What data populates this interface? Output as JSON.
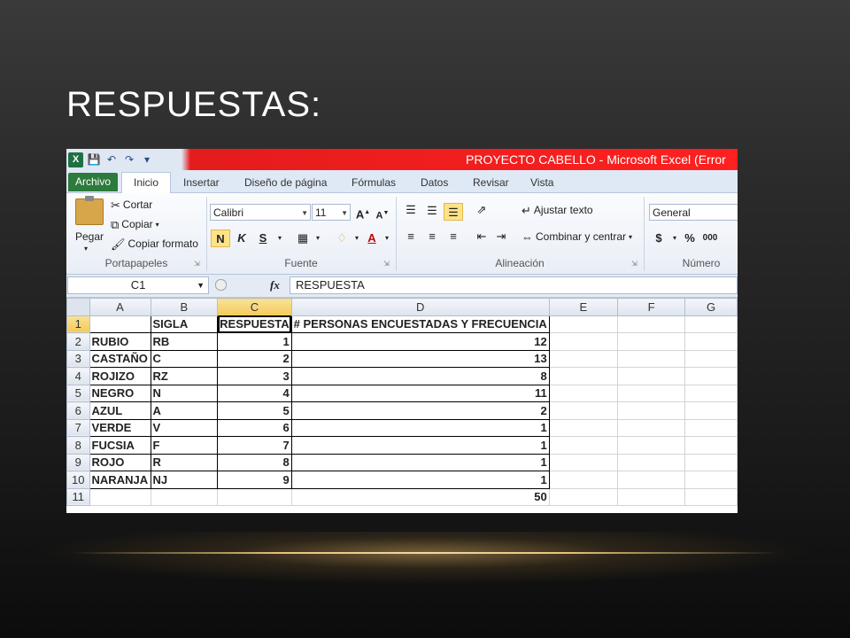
{
  "slide": {
    "title": "RESPUESTAS:"
  },
  "window": {
    "title": "PROYECTO CABELLO  -  Microsoft Excel (Error",
    "logo": "X",
    "qat_icons": [
      "save-icon",
      "undo-icon",
      "redo-icon",
      "customize-qat-icon"
    ]
  },
  "tabs": [
    "Archivo",
    "Inicio",
    "Insertar",
    "Diseño de página",
    "Fórmulas",
    "Datos",
    "Revisar",
    "Vista"
  ],
  "ribbon": {
    "clipboard": {
      "paste": "Pegar",
      "cut": "Cortar",
      "copy": "Copiar",
      "format_painter": "Copiar formato",
      "label": "Portapapeles"
    },
    "font": {
      "name": "Calibri",
      "size": "11",
      "bold": "N",
      "italic": "K",
      "underline": "S",
      "label": "Fuente",
      "grow": "A",
      "shrink": "A"
    },
    "alignment": {
      "wrap": "Ajustar texto",
      "merge": "Combinar y centrar",
      "label": "Alineación"
    },
    "number": {
      "format": "General",
      "currency": "$",
      "percent": "%",
      "thousands": "000",
      "label": "Número"
    }
  },
  "formula_bar": {
    "cell": "C1",
    "fx": "fx",
    "content": "RESPUESTA"
  },
  "sheet": {
    "columns": [
      "A",
      "B",
      "C",
      "D",
      "E",
      "F",
      "G"
    ],
    "selected_column": "C",
    "rows": [
      {
        "n": "1",
        "a": "",
        "b": "SIGLA",
        "c": "RESPUESTA",
        "d": "# PERSONAS ENCUESTADAS Y FRECUENCIA"
      },
      {
        "n": "2",
        "a": "RUBIO",
        "b": "RB",
        "c": "1",
        "d": "12"
      },
      {
        "n": "3",
        "a": "CASTAÑO",
        "b": "C",
        "c": "2",
        "d": "13"
      },
      {
        "n": "4",
        "a": "ROJIZO",
        "b": "RZ",
        "c": "3",
        "d": "8"
      },
      {
        "n": "5",
        "a": "NEGRO",
        "b": "N",
        "c": "4",
        "d": "11"
      },
      {
        "n": "6",
        "a": "AZUL",
        "b": "A",
        "c": "5",
        "d": "2"
      },
      {
        "n": "7",
        "a": "VERDE",
        "b": "V",
        "c": "6",
        "d": "1"
      },
      {
        "n": "8",
        "a": "FUCSIA",
        "b": "F",
        "c": "7",
        "d": "1"
      },
      {
        "n": "9",
        "a": "ROJO",
        "b": "R",
        "c": "8",
        "d": "1"
      },
      {
        "n": "10",
        "a": "NARANJA",
        "b": "NJ",
        "c": "9",
        "d": "1"
      },
      {
        "n": "11",
        "a": "",
        "b": "",
        "c": "",
        "d": "50"
      }
    ]
  }
}
